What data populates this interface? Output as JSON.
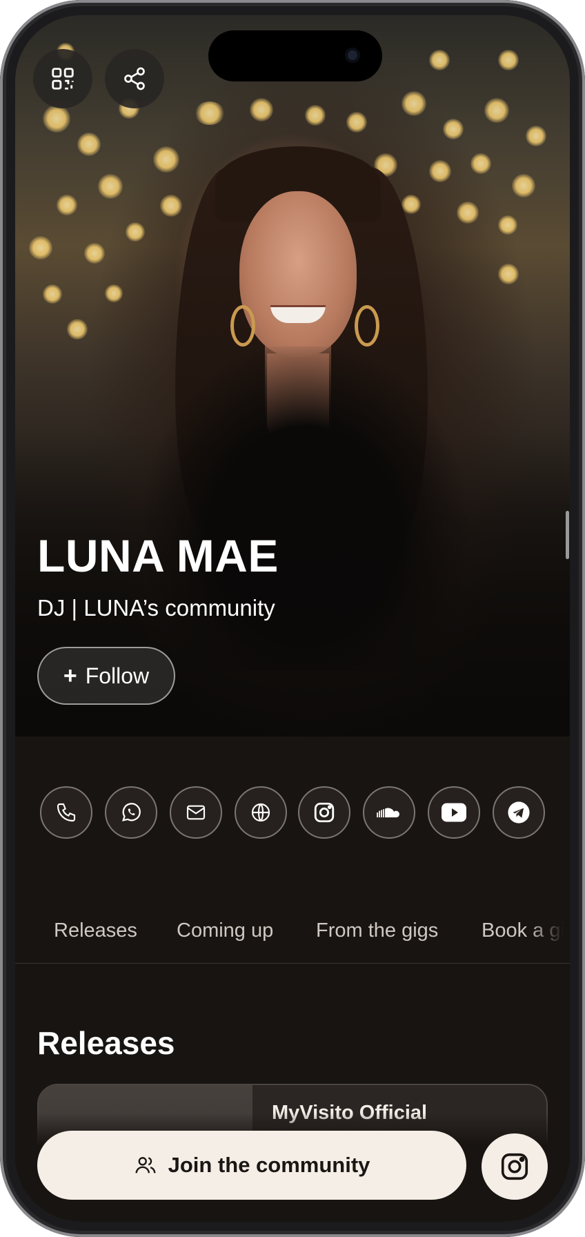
{
  "header": {
    "qr_button": "qr-code-icon",
    "share_button": "share-icon"
  },
  "profile": {
    "name": "LUNA MAE",
    "subtitle": "DJ | LUNA’s community",
    "follow_plus": "+",
    "follow_label": "Follow"
  },
  "contacts": [
    {
      "name": "phone-icon"
    },
    {
      "name": "whatsapp-icon"
    },
    {
      "name": "email-icon"
    },
    {
      "name": "website-icon"
    },
    {
      "name": "instagram-icon"
    },
    {
      "name": "soundcloud-icon"
    },
    {
      "name": "youtube-icon"
    },
    {
      "name": "telegram-icon"
    }
  ],
  "tabs": [
    {
      "label": "Releases"
    },
    {
      "label": "Coming up"
    },
    {
      "label": "From the gigs"
    },
    {
      "label": "Book a gig"
    }
  ],
  "releases": {
    "title": "Releases",
    "card_title": "MyVisito Official"
  },
  "footer": {
    "join_label": "Join the community",
    "instagram_button": "instagram-icon"
  },
  "colors": {
    "background": "#181411",
    "button_light": "#f4eee6",
    "text": "#ffffff"
  }
}
